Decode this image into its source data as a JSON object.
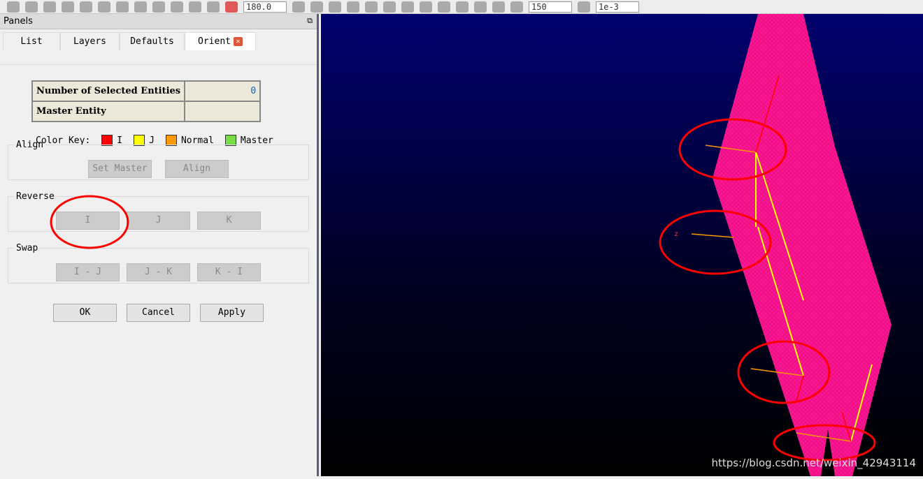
{
  "toolbar": {
    "angle_value": "180.0",
    "density_value": "150",
    "tolerance_value": "1e-3"
  },
  "panel": {
    "title": "Panels",
    "tabs": [
      {
        "label": "List"
      },
      {
        "label": "Layers"
      },
      {
        "label": "Defaults"
      },
      {
        "label": "Orient"
      }
    ],
    "info": {
      "selected_label": "Number of Selected Entities",
      "selected_value": "0",
      "master_label": "Master Entity",
      "master_value": ""
    },
    "color_key": {
      "label": "Color Key:",
      "items": [
        {
          "label": "I",
          "color": "#ff0000"
        },
        {
          "label": "J",
          "color": "#ffff00"
        },
        {
          "label": "Normal",
          "color": "#ff9900"
        },
        {
          "label": "Master",
          "color": "#77dd44"
        }
      ]
    },
    "align": {
      "title": "Align",
      "set_master": "Set Master",
      "align": "Align"
    },
    "reverse": {
      "title": "Reverse",
      "i": "I",
      "j": "J",
      "k": "K"
    },
    "swap": {
      "title": "Swap",
      "ij": "I - J",
      "jk": "J - K",
      "ki": "K - I"
    },
    "actions": {
      "ok": "OK",
      "cancel": "Cancel",
      "apply": "Apply"
    }
  },
  "viewport": {
    "axis_label": "z",
    "mesh_color": "#ff1493",
    "highlight_color": "#ff0000"
  },
  "watermark": "https://blog.csdn.net/weixin_42943114"
}
